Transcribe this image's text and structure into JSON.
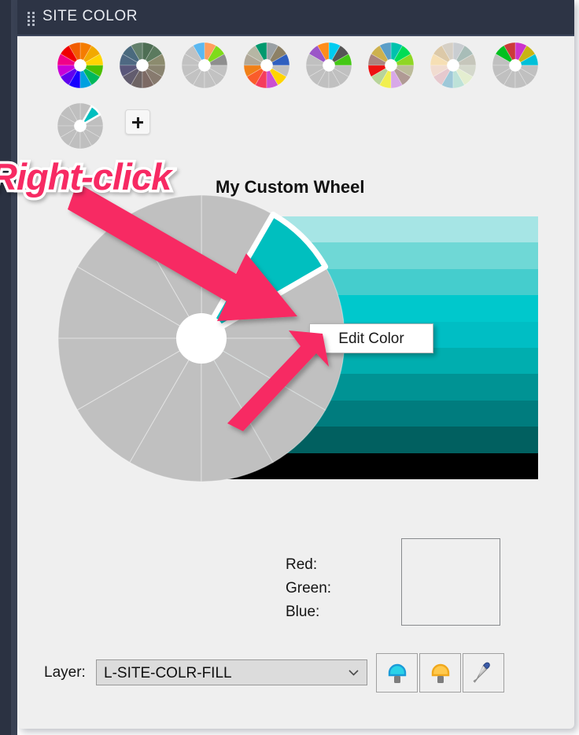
{
  "window": {
    "title": "SITE COLOR",
    "grip_icon": "drag-grip-icon",
    "titlebar_color": "#2d3445",
    "panel_bg": "#efefef"
  },
  "palette_strip": {
    "add_button_label": "+",
    "add_button_icon": "plus-icon",
    "thumbnails": [
      {
        "name": "wheel-full-spectrum",
        "selected": false,
        "colors": [
          "#ffd400",
          "#f2a900",
          "#f57c00",
          "#f25c00",
          "#ef0000",
          "#f10089",
          "#c800d8",
          "#6000ee",
          "#1800ff",
          "#00a0e0",
          "#00b85a",
          "#4cc000"
        ]
      },
      {
        "name": "wheel-muted-olive",
        "selected": false,
        "colors": [
          "#8c8b6e",
          "#5b7a5e",
          "#4e6e54",
          "#63806b",
          "#4a6a7e",
          "#4e6882",
          "#59567a",
          "#625c6e",
          "#6e6464",
          "#7d6a64",
          "#877a6e",
          "#8a8470"
        ]
      },
      {
        "name": "wheel-gray-accent-green",
        "selected": false,
        "colors": [
          "#8e8e8e",
          "#7fdb1a",
          "#ff9e5e",
          "#5bb8f0",
          "#c2c2c2",
          "#c2c2c2",
          "#c2c2c2",
          "#c2c2c2",
          "#c2c2c2",
          "#c2c2c2",
          "#c2c2c2",
          "#c2c2c2"
        ]
      },
      {
        "name": "wheel-mixed-bright",
        "selected": false,
        "colors": [
          "#2f5fbf",
          "#8d8166",
          "#9aa0a4",
          "#00996e",
          "#b6b6a4",
          "#b0a898",
          "#f08018",
          "#fa5c2a",
          "#f53c5c",
          "#cc4fd0",
          "#ffd400",
          "#c0c0c0"
        ]
      },
      {
        "name": "wheel-gray-accent-teal",
        "selected": false,
        "colors": [
          "#44c814",
          "#555555",
          "#00ccf0",
          "#ff8c1a",
          "#9b56c8",
          "#c0c0c0",
          "#c0c0c0",
          "#c0c0c0",
          "#c0c0c0",
          "#c0c0c0",
          "#c0c0c0",
          "#c0c0c0"
        ]
      },
      {
        "name": "wheel-pastel-rainbow",
        "selected": false,
        "colors": [
          "#8fd624",
          "#00dd55",
          "#00c2ad",
          "#5b9ec8",
          "#cdb14e",
          "#a98480",
          "#ee1111",
          "#b8d49a",
          "#f1ef4f",
          "#d8a8e8",
          "#b09a94",
          "#bcbc9a"
        ]
      },
      {
        "name": "wheel-very-pale",
        "selected": false,
        "colors": [
          "#c6c6bb",
          "#a8bdb8",
          "#c9cdd1",
          "#d6d0c6",
          "#dcc9a8",
          "#f6dfb4",
          "#f1dcd0",
          "#e6c9ce",
          "#9ec8d8",
          "#bde2d8",
          "#e4eed0",
          "#d4d8cc"
        ]
      },
      {
        "name": "wheel-gray-accent-magenta",
        "selected": false,
        "colors": [
          "#00c0d8",
          "#c8b414",
          "#cc33cc",
          "#cc3a3a",
          "#00c020",
          "#c0c0c0",
          "#c0c0c0",
          "#c0c0c0",
          "#c0c0c0",
          "#c0c0c0",
          "#c0c0c0",
          "#c0c0c0"
        ]
      },
      {
        "name": "wheel-my-custom",
        "selected": true,
        "colors": [
          "#bfbfbf",
          "#00bfbf",
          "#bfbfbf",
          "#bfbfbf",
          "#bfbfbf",
          "#bfbfbf",
          "#bfbfbf",
          "#bfbfbf",
          "#bfbfbf",
          "#bfbfbf",
          "#bfbfbf",
          "#bfbfbf"
        ]
      }
    ]
  },
  "wheel": {
    "title": "My Custom Wheel",
    "segment_count": 12,
    "base_color": "#c0c0c0",
    "selected_segment_index": 1,
    "selected_segment_color": "#00bfbf",
    "hub_color": "#ffffff",
    "selected_outline_color": "#ffffff"
  },
  "gradient": {
    "bands": [
      "#a6e5e5",
      "#6fd8d6",
      "#45cdcd",
      "#00c8cc",
      "#00bec4",
      "#00aeaf",
      "#009394",
      "#007c7e",
      "#016060",
      "#000000"
    ],
    "band_count": 10
  },
  "context_menu": {
    "items": [
      {
        "label": "Edit Color",
        "name": "menu-item-edit-color"
      }
    ]
  },
  "annotation": {
    "text": "Right-click",
    "color": "#f72a63",
    "outline_color": "#ffffff",
    "arrow_color": "#f72a63"
  },
  "rgb_readout": {
    "red_label": "Red:",
    "green_label": "Green:",
    "blue_label": "Blue:",
    "red_value": "",
    "green_value": "",
    "blue_value": "",
    "preview_color": "#efefef"
  },
  "layer_row": {
    "label": "Layer:",
    "selected": "L-SITE-COLR-FILL",
    "options": [
      "L-SITE-COLR-FILL"
    ],
    "chevron_icon": "chevron-down-icon",
    "buttons": [
      {
        "name": "layer-on-button",
        "icon": "lightbulb-on-icon",
        "bulb_color": "#2ad2e8",
        "bulb_stroke": "#1b9bd8"
      },
      {
        "name": "layer-off-button",
        "icon": "lightbulb-off-icon",
        "bulb_color": "#ffc94d",
        "bulb_stroke": "#f0a81c"
      },
      {
        "name": "eyedropper-button",
        "icon": "eyedropper-icon",
        "bulb_color": "#3b5ba8",
        "tube_color": "#b8b8b8"
      }
    ]
  }
}
